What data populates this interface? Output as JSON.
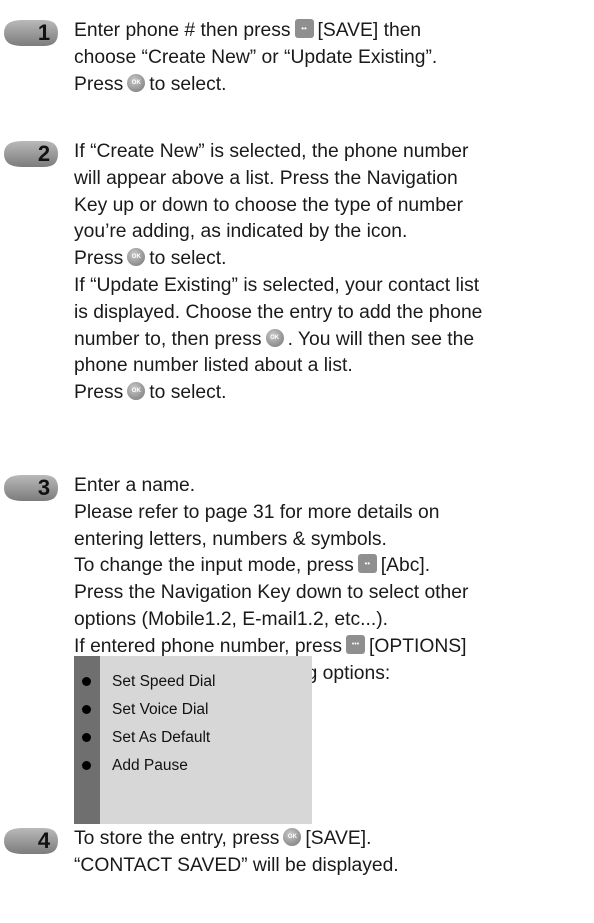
{
  "steps": [
    {
      "number": "1",
      "lines": [
        [
          "Enter phone # then press",
          "softkey",
          "[SAVE] then"
        ],
        [
          "choose “Create New” or “Update Existing”."
        ],
        [
          "Press",
          "ok",
          "to select."
        ]
      ]
    },
    {
      "number": "2",
      "lines": [
        [
          "If “Create New” is selected, the phone number"
        ],
        [
          "will appear above a list. Press the Navigation"
        ],
        [
          "Key up or down to choose the type of number"
        ],
        [
          "you’re adding, as indicated by the icon."
        ],
        [
          "Press",
          "ok",
          "to select."
        ],
        [
          "If “Update Existing” is selected, your contact list"
        ],
        [
          "is displayed. Choose the entry to add the phone"
        ],
        [
          "number to, then press",
          "ok",
          ". You will then see the"
        ],
        [
          "phone number listed about a list."
        ],
        [
          "Press",
          "ok",
          "to select."
        ]
      ]
    },
    {
      "number": "3",
      "lines": [
        [
          "Enter a name."
        ],
        [
          "Please refer to page 31 for more details on"
        ],
        [
          "entering letters, numbers & symbols."
        ],
        [
          "To change the input mode, press",
          "softkey",
          "[Abc]."
        ],
        [
          "Press the Navigation Key down to select other"
        ],
        [
          "options (Mobile1.2, E-mail1.2, etc...)."
        ],
        [
          "If entered phone number, press",
          "softkey3",
          "[OPTIONS]"
        ],
        [
          "to select one of the following options:"
        ]
      ]
    },
    {
      "number": "4",
      "lines": [
        [
          "To store the entry, press",
          "ok",
          "[SAVE]."
        ],
        [
          "“CONTACT SAVED” will be displayed."
        ]
      ]
    }
  ],
  "options": [
    "Set Speed Dial",
    "Set Voice Dial",
    "Set As Default",
    "Add Pause"
  ],
  "colors": {
    "badge": "#8a8a8a",
    "option_bar": "#6f6f6f",
    "option_panel": "#d7d7d7",
    "text": "#1a1a1a"
  },
  "icons": {
    "ok": "ok-button-icon",
    "softkey": "softkey-button-icon",
    "softkey3": "options-softkey-icon"
  }
}
